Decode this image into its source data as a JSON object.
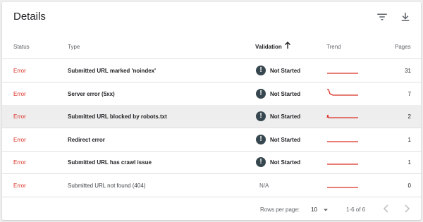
{
  "header": {
    "title": "Details",
    "filter_icon": "filter-icon",
    "download_icon": "download-icon"
  },
  "columns": {
    "status": "Status",
    "type": "Type",
    "validation": "Validation",
    "trend": "Trend",
    "pages": "Pages"
  },
  "rows": [
    {
      "status": "Error",
      "type": "Submitted URL marked 'noindex'",
      "validation": "Not Started",
      "pages": "31"
    },
    {
      "status": "Error",
      "type": "Server error (5xx)",
      "validation": "Not Started",
      "pages": "7"
    },
    {
      "status": "Error",
      "type": "Submitted URL blocked by robots.txt",
      "validation": "Not Started",
      "pages": "2"
    },
    {
      "status": "Error",
      "type": "Redirect error",
      "validation": "Not Started",
      "pages": "1"
    },
    {
      "status": "Error",
      "type": "Submitted URL has crawl issue",
      "validation": "Not Started",
      "pages": "1"
    },
    {
      "status": "Error",
      "type": "Submitted URL not found (404)",
      "validation": "N/A",
      "pages": "0"
    }
  ],
  "validation_icon_glyph": "!",
  "footer": {
    "rows_per_page_label": "Rows per page:",
    "rows_per_page_value": "10",
    "range": "1-6 of 6"
  },
  "colors": {
    "error": "#d93025",
    "accent": "#37474f"
  }
}
